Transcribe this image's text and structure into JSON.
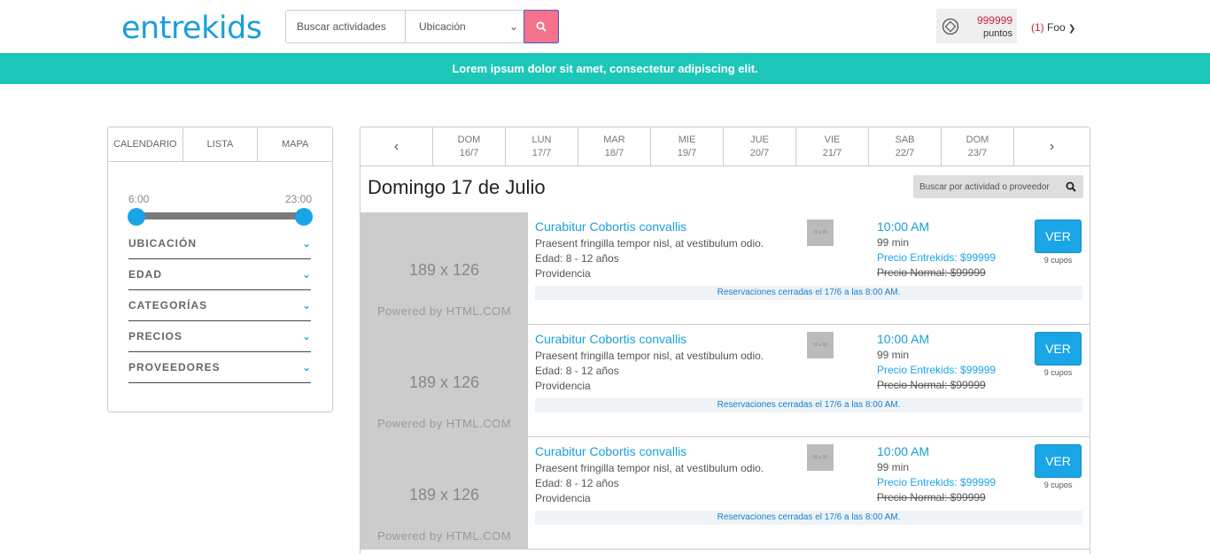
{
  "header": {
    "logo": "entrekids",
    "search_placeholder": "Buscar actividades",
    "location_label": "Ubicación",
    "points_value": "999999",
    "points_label": "puntos",
    "notifications_count": "(1)",
    "user_name": "Foo"
  },
  "banner": {
    "text": "Lorem ipsum dolor sit amet, consectetur adipiscing elit."
  },
  "sidebar": {
    "tabs": [
      "CALENDARIO",
      "LISTA",
      "MAPA"
    ],
    "time_range": {
      "min_label": "6:00",
      "max_label": "23:00"
    },
    "filters": [
      "UBICACIÓN",
      "EDAD",
      "CATEGORÍAS",
      "PRECIOS",
      "PROVEEDORES"
    ]
  },
  "calendar": {
    "days": [
      {
        "name": "DOM",
        "date": "16/7"
      },
      {
        "name": "LUN",
        "date": "17/7"
      },
      {
        "name": "MAR",
        "date": "18/7"
      },
      {
        "name": "MIE",
        "date": "19/7"
      },
      {
        "name": "JUE",
        "date": "20/7"
      },
      {
        "name": "VIE",
        "date": "21/7"
      },
      {
        "name": "SAB",
        "date": "22/7"
      },
      {
        "name": "DOM",
        "date": "23/7"
      }
    ],
    "prev_symbol": "‹",
    "next_symbol": "›"
  },
  "main": {
    "day_title": "Domingo 17 de Julio",
    "provider_search_placeholder": "Buscar por actividad o proveedor"
  },
  "activities": [
    {
      "thumb_size": "189 x 126",
      "thumb_powered": "Powered by HTML.COM",
      "title": "Curabitur Cobortis convallis",
      "description": "Praesent fringilla tempor nisl, at vestibulum odio.",
      "age": "Edad: 8 - 12 años",
      "location": "Providencia",
      "mini_thumb": "30 x 30",
      "time": "10:00 AM",
      "duration": "99 min",
      "price_entrekids": "Precio Entrekids: $99999",
      "price_normal": "Precio Normal: $99999",
      "button": "VER",
      "cupos": "9 cupos",
      "closed_notice": "Reservaciones cerradas el 17/6 a las 8:00 AM."
    },
    {
      "thumb_size": "189 x 126",
      "thumb_powered": "Powered by HTML.COM",
      "title": "Curabitur Cobortis convallis",
      "description": "Praesent fringilla tempor nisl, at vestibulum odio.",
      "age": "Edad: 8 - 12 años",
      "location": "Providencia",
      "mini_thumb": "30 x 30",
      "time": "10:00 AM",
      "duration": "99 min",
      "price_entrekids": "Precio Entrekids: $99999",
      "price_normal": "Precio Normal: $99999",
      "button": "VER",
      "cupos": "9 cupos",
      "closed_notice": "Reservaciones cerradas el 17/6 a las 8:00 AM."
    },
    {
      "thumb_size": "189 x 126",
      "thumb_powered": "Powered by HTML.COM",
      "title": "Curabitur Cobortis convallis",
      "description": "Praesent fringilla tempor nisl, at vestibulum odio.",
      "age": "Edad: 8 - 12 años",
      "location": "Providencia",
      "mini_thumb": "30 x 30",
      "time": "10:00 AM",
      "duration": "99 min",
      "price_entrekids": "Precio Entrekids: $99999",
      "price_normal": "Precio Normal: $99999",
      "button": "VER",
      "cupos": "9 cupos",
      "closed_notice": "Reservaciones cerradas el 17/6 a las 8:00 AM."
    }
  ],
  "colors": {
    "brand": "#1a9fd9",
    "banner": "#1cc7b8",
    "search_button": "#f4728b",
    "accent_red": "#d0213c"
  }
}
